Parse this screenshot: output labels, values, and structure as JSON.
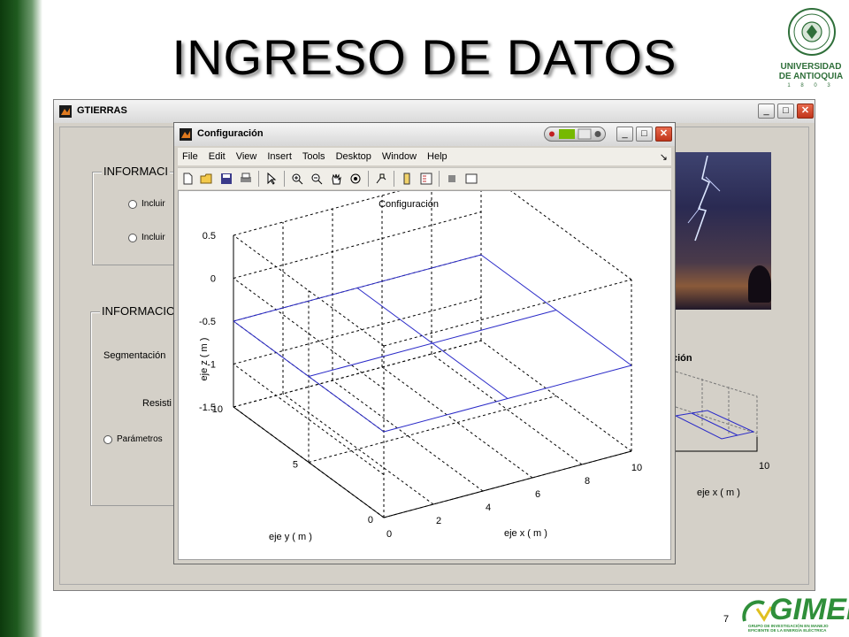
{
  "slide": {
    "title": "INGRESO DE DATOS",
    "page_number": "7",
    "udea": {
      "line1": "UNIVERSIDAD",
      "line2": "DE ANTIOQUIA",
      "year": "1 8 0 3"
    },
    "gimel": {
      "logo": "GIMEL",
      "subtitle": "GRUPO DE INVESTIGACIÓN EN MANEJO EFICIENTE DE LA ENERGÍA ELÉCTRICA"
    }
  },
  "main_window": {
    "title": "GTIERRAS",
    "panel1": {
      "title": "INFORMACI",
      "radio1": "Incluir",
      "radio2": "Incluir"
    },
    "panel2": {
      "title": "INFORMACIO",
      "seg_label": "Segmentación",
      "res_label": "Resisti",
      "radio": "Parámetros"
    },
    "right_plot": {
      "title_fragment": "ción",
      "xlabel": "eje x ( m )",
      "tick_10": "10"
    }
  },
  "figure_window": {
    "title": "Configuración",
    "menu": [
      "File",
      "Edit",
      "View",
      "Insert",
      "Tools",
      "Desktop",
      "Window",
      "Help"
    ]
  },
  "chart_data": {
    "type": "line",
    "projection": "3d",
    "title": "Configuración",
    "xlabel": "eje x ( m )",
    "ylabel": "eje y ( m )",
    "zlabel": "eje z ( m )",
    "xlim": [
      0,
      10
    ],
    "ylim": [
      0,
      10
    ],
    "zlim": [
      -1.5,
      0.5
    ],
    "xticks": [
      "0",
      "2",
      "4",
      "6",
      "8",
      "10"
    ],
    "yticks": [
      "0",
      "5",
      "10"
    ],
    "zticks": [
      "0.5",
      "0",
      "-0.5",
      "-1",
      "-1.5"
    ],
    "grid": true,
    "series": [
      {
        "color": "#2a2ac8",
        "z": -0.5,
        "segments": [
          [
            [
              0,
              0
            ],
            [
              10,
              0
            ]
          ],
          [
            [
              0,
              5
            ],
            [
              10,
              5
            ]
          ],
          [
            [
              0,
              10
            ],
            [
              10,
              10
            ]
          ],
          [
            [
              0,
              0
            ],
            [
              0,
              10
            ]
          ],
          [
            [
              5,
              0
            ],
            [
              5,
              10
            ]
          ],
          [
            [
              10,
              0
            ],
            [
              10,
              10
            ]
          ]
        ]
      }
    ]
  },
  "colors": {
    "accent": "#2a2ac8",
    "green": "#1f5a1f"
  }
}
